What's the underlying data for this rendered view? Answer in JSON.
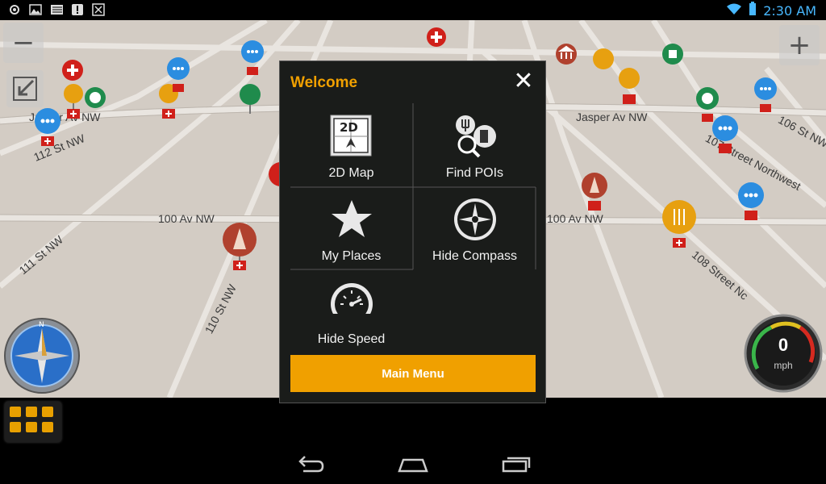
{
  "status_bar": {
    "icons": [
      "gps-icon",
      "image-icon",
      "tv-icon",
      "alert-icon",
      "close-box-icon"
    ],
    "time": "2:30 AM"
  },
  "map": {
    "streets": [
      {
        "name": "112 St NW"
      },
      {
        "name": "Jasper Av NW"
      },
      {
        "name": "100 Av NW"
      },
      {
        "name": "111 St NW"
      },
      {
        "name": "110 St NW"
      },
      {
        "name": "Jasper Av NW"
      },
      {
        "name": "106 St NW"
      },
      {
        "name": "107 Street Northwest"
      },
      {
        "name": "100 Av NW"
      },
      {
        "name": "108 Street Nc"
      }
    ],
    "zoom_out_label": "−",
    "zoom_in_label": "+"
  },
  "speedometer": {
    "speed": "0",
    "unit": "mph"
  },
  "dialog": {
    "title": "Welcome",
    "close_label": "✕",
    "tiles": [
      {
        "label": "2D Map",
        "icon": "2d-map-icon"
      },
      {
        "label": "Find POIs",
        "icon": "find-pois-icon"
      },
      {
        "label": "My Places",
        "icon": "star-icon"
      },
      {
        "label": "Hide Compass",
        "icon": "compass-icon"
      },
      {
        "label": "Hide Speed",
        "icon": "speedometer-icon"
      }
    ],
    "main_menu_label": "Main Menu",
    "badge_2d": "2D"
  },
  "colors": {
    "accent": "#f0a000",
    "dialog_bg": "#1a1c1a",
    "map_bg": "#d3ccc4"
  }
}
